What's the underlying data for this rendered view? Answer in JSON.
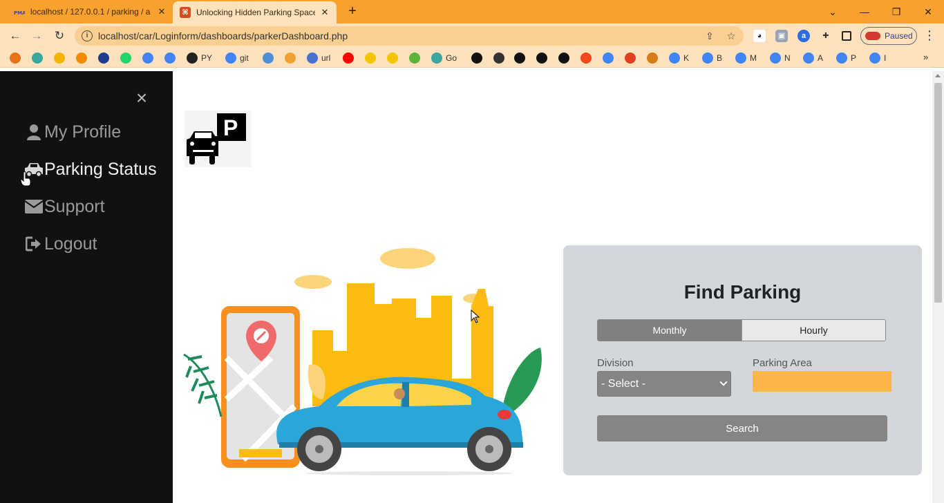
{
  "browser": {
    "tabs": [
      {
        "title": "localhost / 127.0.0.1 / parking / a",
        "favicon": "pma-icon",
        "active": false
      },
      {
        "title": "Unlocking Hidden Parking Space",
        "favicon": "site-icon",
        "active": true
      }
    ],
    "window_controls": {
      "minimize": "—",
      "restore": "❐",
      "close": "✕",
      "tablist": "⌄"
    },
    "address": "localhost/car/Loginform/dashboards/parkerDashboard.php",
    "profile_status": "Paused",
    "bookmarks": [
      {
        "label": "",
        "color": "#e8711a"
      },
      {
        "label": "",
        "color": "#3aa6a0"
      },
      {
        "label": "",
        "color": "#f2b400"
      },
      {
        "label": "",
        "color": "#f28b00"
      },
      {
        "label": "",
        "color": "#1c3d8c"
      },
      {
        "label": "",
        "color": "#25d366"
      },
      {
        "label": "",
        "color": "#4285f4"
      },
      {
        "label": "",
        "color": "#4285f4"
      },
      {
        "label": "PY",
        "color": "#222222"
      },
      {
        "label": "git",
        "color": "#4285f4"
      },
      {
        "label": "",
        "color": "#4a90d9"
      },
      {
        "label": "",
        "color": "#f0a030"
      },
      {
        "label": "url",
        "color": "#4a70d0"
      },
      {
        "label": "",
        "color": "#ff0000"
      },
      {
        "label": "",
        "color": "#f5c400"
      },
      {
        "label": "",
        "color": "#f5c400"
      },
      {
        "label": "",
        "color": "#5fb33a"
      },
      {
        "label": "Go",
        "color": "#3aa6a0"
      },
      {
        "label": "",
        "color": "#111111"
      },
      {
        "label": "",
        "color": "#333333"
      },
      {
        "label": "",
        "color": "#111111"
      },
      {
        "label": "",
        "color": "#111111"
      },
      {
        "label": "",
        "color": "#111111"
      },
      {
        "label": "",
        "color": "#f24a1e"
      },
      {
        "label": "",
        "color": "#4285f4"
      },
      {
        "label": "",
        "color": "#e04020"
      },
      {
        "label": "",
        "color": "#d97a1a"
      },
      {
        "label": "K",
        "color": "#4285f4"
      },
      {
        "label": "B",
        "color": "#4285f4"
      },
      {
        "label": "M",
        "color": "#4285f4"
      },
      {
        "label": "N",
        "color": "#4285f4"
      },
      {
        "label": "A",
        "color": "#4285f4"
      },
      {
        "label": "P",
        "color": "#4285f4"
      },
      {
        "label": "I",
        "color": "#4285f4"
      }
    ],
    "bookmarks_more": "»"
  },
  "sidebar": {
    "close": "×",
    "items": [
      {
        "label": "My Profile",
        "icon": "user-icon",
        "active": false
      },
      {
        "label": "Parking Status",
        "icon": "car-icon",
        "active": true
      },
      {
        "label": "Support",
        "icon": "envelope-icon",
        "active": false
      },
      {
        "label": "Logout",
        "icon": "logout-icon",
        "active": false
      }
    ]
  },
  "logo": {
    "letter": "P"
  },
  "find_parking": {
    "title": "Find Parking",
    "tabs": {
      "monthly": "Monthly",
      "hourly": "Hourly",
      "selected": "Monthly"
    },
    "division_label": "Division",
    "division_value": "- Select -",
    "parking_area_label": "Parking Area",
    "parking_area_value": "",
    "search_label": "Search"
  },
  "colors": {
    "accent": "#f9a12e",
    "sidebar_bg": "#111111",
    "card_bg": "#d3d6db",
    "parking_area_fill": "#fbb548",
    "button_grey": "#858585"
  }
}
